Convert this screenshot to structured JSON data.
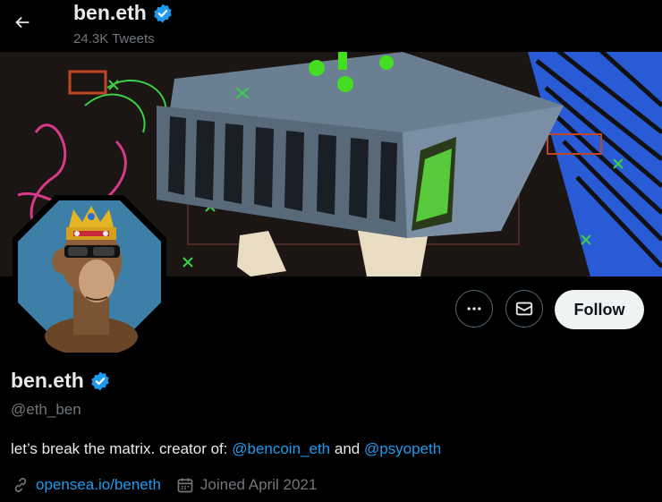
{
  "header": {
    "display_name": "ben.eth",
    "tweet_count": "24.3K Tweets",
    "verified": true
  },
  "profile": {
    "display_name": "ben.eth",
    "handle": "@eth_ben",
    "verified": true,
    "bio": {
      "text_before": "let’s break the matrix. creator of: ",
      "mention_1": "@bencoin_eth",
      "connector": " and ",
      "mention_2": "@psyopeth"
    },
    "website": "opensea.io/beneth",
    "joined": "Joined April 2021"
  },
  "actions": {
    "more_icon": "more-horizontal-icon",
    "message_icon": "envelope-icon",
    "follow_label": "Follow"
  },
  "colors": {
    "background": "#000000",
    "text": "#e7e9ea",
    "muted": "#71767b",
    "link": "#1d9bf0",
    "verified": "#1d9bf0",
    "follow_bg": "#eff3f4",
    "avatar_bg": "#3d7fa6",
    "banner_accent": "#44dd22"
  }
}
